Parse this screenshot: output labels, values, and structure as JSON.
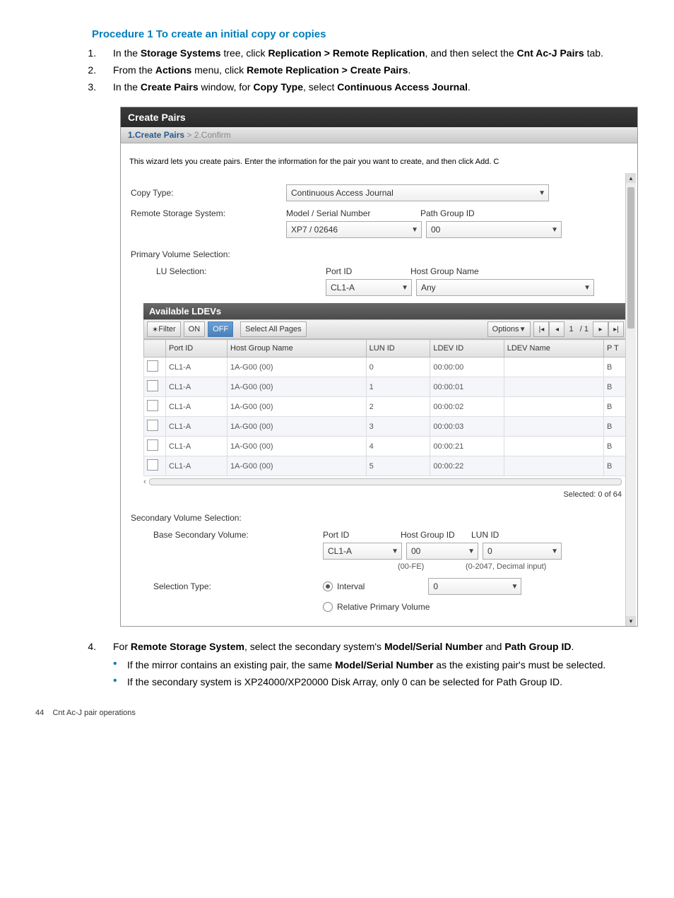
{
  "procedure_title": "Procedure 1 To create an initial copy or copies",
  "steps": {
    "s1_a": "In the ",
    "s1_b": "Storage Systems",
    "s1_c": " tree, click ",
    "s1_d": "Replication > Remote Replication",
    "s1_e": ", and then select the ",
    "s1_f": "Cnt Ac-J Pairs",
    "s1_g": " tab.",
    "s2_a": "From the ",
    "s2_b": "Actions",
    "s2_c": " menu, click ",
    "s2_d": "Remote Replication > Create Pairs",
    "s2_e": ".",
    "s3_a": "In the ",
    "s3_b": "Create Pairs",
    "s3_c": " window, for ",
    "s3_d": "Copy Type",
    "s3_e": ", select ",
    "s3_f": "Continuous Access Journal",
    "s3_g": ".",
    "s4_a": "For ",
    "s4_b": "Remote Storage System",
    "s4_c": ", select the secondary system's ",
    "s4_d": "Model/Serial Number",
    "s4_e": " and ",
    "s4_f": "Path Group ID",
    "s4_g": "."
  },
  "bullets": {
    "b1_a": "If the mirror contains an existing pair, the same ",
    "b1_b": "Model/Serial Number",
    "b1_c": " as the existing pair's must be selected.",
    "b2": "If the secondary system is XP24000/XP20000 Disk Array, only 0 can be selected for Path Group ID."
  },
  "dialog": {
    "title": "Create Pairs",
    "crumb1": "1.Create Pairs",
    "crumb_sep": ">",
    "crumb2": "2.Confirm",
    "instruction": "This wizard lets you create pairs. Enter the information for the pair you want to create, and then click Add. C",
    "copy_type_label": "Copy Type:",
    "copy_type_value": "Continuous Access Journal",
    "remote_label": "Remote Storage System:",
    "model_label": "Model / Serial Number",
    "path_label": "Path Group ID",
    "model_value": "XP7 / 02646",
    "path_value": "00",
    "primary_label": "Primary Volume Selection:",
    "lu_label": "LU Selection:",
    "portid_label": "Port ID",
    "hostgroup_label": "Host Group Name",
    "portid_value": "CL1-A",
    "hostgroup_value": "Any",
    "available_header": "Available LDEVs",
    "filter_label": "Filter",
    "on": "ON",
    "off": "OFF",
    "select_all": "Select All Pages",
    "options": "Options",
    "page_current": "1",
    "page_total": "/ 1",
    "th_port": "Port ID",
    "th_hg": "Host Group Name",
    "th_lun": "LUN ID",
    "th_ldev": "LDEV ID",
    "th_ldevname": "LDEV Name",
    "th_pt": "P T",
    "rows": [
      {
        "port": "CL1-A",
        "hg": "1A-G00 (00)",
        "lun": "0",
        "ldev": "00:00:00",
        "name": "",
        "pt": "B"
      },
      {
        "port": "CL1-A",
        "hg": "1A-G00 (00)",
        "lun": "1",
        "ldev": "00:00:01",
        "name": "",
        "pt": "B"
      },
      {
        "port": "CL1-A",
        "hg": "1A-G00 (00)",
        "lun": "2",
        "ldev": "00:00:02",
        "name": "",
        "pt": "B"
      },
      {
        "port": "CL1-A",
        "hg": "1A-G00 (00)",
        "lun": "3",
        "ldev": "00:00:03",
        "name": "",
        "pt": "B"
      },
      {
        "port": "CL1-A",
        "hg": "1A-G00 (00)",
        "lun": "4",
        "ldev": "00:00:21",
        "name": "",
        "pt": "B"
      },
      {
        "port": "CL1-A",
        "hg": "1A-G00 (00)",
        "lun": "5",
        "ldev": "00:00:22",
        "name": "",
        "pt": "B"
      }
    ],
    "selected_label": "Selected:  0   of  64",
    "secondary_label": "Secondary Volume Selection:",
    "base_secondary_label": "Base Secondary Volume:",
    "sec_port_label": "Port ID",
    "sec_hg_label": "Host Group ID",
    "sec_lun_label": "LUN ID",
    "sec_port_value": "CL1-A",
    "sec_hg_value": "00",
    "sec_lun_value": "0",
    "sec_hg_hint": "(00-FE)",
    "sec_lun_hint": "(0-2047, Decimal input)",
    "seltype_label": "Selection Type:",
    "radio_interval": "Interval",
    "radio_relative": "Relative Primary Volume",
    "interval_value": "0"
  },
  "footer": {
    "page": "44",
    "chapter": "Cnt Ac-J pair operations"
  }
}
